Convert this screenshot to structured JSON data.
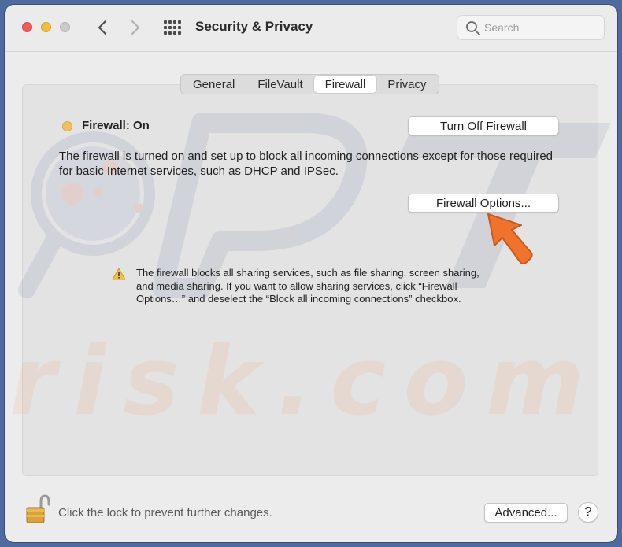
{
  "window": {
    "title": "Security & Privacy",
    "search_placeholder": "Search"
  },
  "tabs": [
    {
      "label": "General",
      "active": false
    },
    {
      "label": "FileVault",
      "active": false
    },
    {
      "label": "Firewall",
      "active": true
    },
    {
      "label": "Privacy",
      "active": false
    }
  ],
  "firewall": {
    "status_label": "Firewall: On",
    "status_color": "#eec15c",
    "turn_off_label": "Turn Off Firewall",
    "description": "The firewall is turned on and set up to block all incoming connections except for those required for basic Internet services, such as DHCP and IPSec.",
    "options_label": "Firewall Options...",
    "warning_text": "The firewall blocks all sharing services, such as file sharing, screen sharing, and media sharing. If you want to allow sharing services, click “Firewall Options…” and deselect the “Block all incoming connections” checkbox."
  },
  "footer": {
    "lock_text": "Click the lock to prevent further changes.",
    "advanced_label": "Advanced...",
    "help_label": "?"
  },
  "watermark": {
    "text": "risk.com"
  },
  "colors": {
    "accent_arrow": "#f0722c",
    "close": "#ee5c54",
    "minimize": "#f4bd38",
    "zoom": "#c9c9c9"
  }
}
